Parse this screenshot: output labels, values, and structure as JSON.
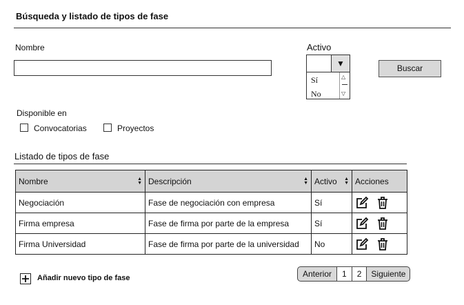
{
  "page": {
    "title": "Búsqueda y listado de tipos de fase"
  },
  "search": {
    "nombre_label": "Nombre",
    "nombre_value": "",
    "activo_label": "Activo",
    "activo_value": "",
    "activo_options": [
      "Sí",
      "No"
    ],
    "buscar_label": "Buscar"
  },
  "disponible": {
    "label": "Disponible en",
    "options": [
      {
        "label": "Convocatorias",
        "checked": false
      },
      {
        "label": "Proyectos",
        "checked": false
      }
    ]
  },
  "list": {
    "title": "Listado de tipos de fase",
    "columns": [
      "Nombre",
      "Descripción",
      "Activo",
      "Acciones"
    ],
    "rows": [
      {
        "nombre": "Negociación",
        "descripcion": "Fase de negociación con empresa",
        "activo": "Sí"
      },
      {
        "nombre": "Firma empresa",
        "descripcion": "Fase de firma por parte de la empresa",
        "activo": "Sí"
      },
      {
        "nombre": "Firma Universidad",
        "descripcion": "Fase de firma por parte de la universidad",
        "activo": "No"
      }
    ]
  },
  "add": {
    "label": "Añadir nuevo tipo de fase"
  },
  "pagination": {
    "prev": "Anterior",
    "pages": [
      "1",
      "2"
    ],
    "next": "Siguiente"
  }
}
